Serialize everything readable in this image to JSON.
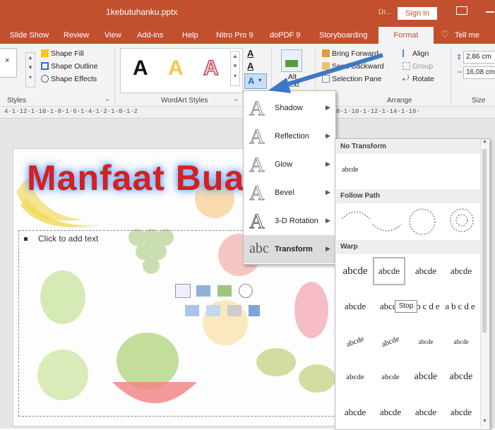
{
  "titlebar": {
    "filename": "1kebutuhanku.pptx",
    "user": "Dr...",
    "signin": "Sign in"
  },
  "tabs": [
    "Slide Show",
    "Review",
    "View",
    "Add-ins",
    "Help",
    "Nitro Pro 9",
    "doPDF 9",
    "Storyboarding",
    "Format",
    "Tell me"
  ],
  "ribbon": {
    "shape_fill": "Shape Fill",
    "shape_outline": "Shape Outline",
    "shape_effects": "Shape Effects",
    "styles_label": "Styles",
    "wordart_styles_label": "WordArt Styles",
    "wordart_sample": "A",
    "alt_text": "Alt Text",
    "bring_forward": "Bring Forward",
    "send_backward": "Send Backward",
    "selection_pane": "Selection Pane",
    "align": "Align",
    "group": "Group",
    "rotate": "Rotate",
    "arrange_label": "Arrange",
    "height": "2,86 cm",
    "width": "16,08 cm",
    "size_label": "Size"
  },
  "ruler": "4·1·12·1·10·1·8·1·6·1·4·1·2·1·0·1·2",
  "ruler_right": "8·1·10·1·12·1·14·1·16·",
  "slide": {
    "title": "Manfaat Bua",
    "placeholder": "Click to add text"
  },
  "effects_menu": {
    "glyph": "A",
    "transform_glyph": "abc",
    "items": [
      "Shadow",
      "Reflection",
      "Glow",
      "Bevel",
      "3-D Rotation",
      "Transform"
    ]
  },
  "transform": {
    "no_transform": "No Transform",
    "no_transform_sample": "abcde",
    "follow_path": "Follow Path",
    "warp": "Warp",
    "cell_text": "abcde",
    "tooltip": "Stop"
  },
  "colors": {
    "office_accent": "#c2502e",
    "title_red": "#d61f1f",
    "arrow_blue": "#3c78c8"
  }
}
